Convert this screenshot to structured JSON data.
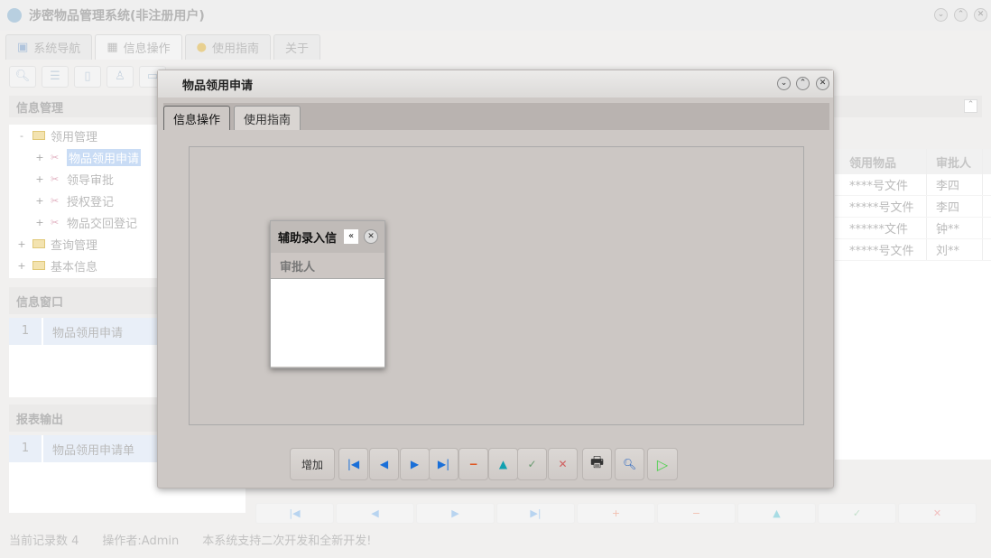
{
  "app": {
    "title": "涉密物品管理系统(非注册用户)",
    "tabs": [
      {
        "label": "系统导航",
        "icon": "monitor-icon"
      },
      {
        "label": "信息操作",
        "icon": "grid-icon"
      },
      {
        "label": "使用指南",
        "icon": "help-icon"
      },
      {
        "label": "关于"
      }
    ],
    "sections": {
      "info_mgmt": "信息管理",
      "info_window": "信息窗口",
      "report": "报表输出"
    },
    "tree": [
      {
        "label": "领用管理",
        "expanded": true,
        "children": [
          "物品领用申请",
          "领导审批",
          "授权登记",
          "物品交回登记"
        ]
      },
      {
        "label": "查询管理"
      },
      {
        "label": "基本信息"
      }
    ],
    "window_list": [
      {
        "n": "1",
        "label": "物品领用申请"
      }
    ],
    "report_list": [
      {
        "n": "1",
        "label": "物品领用申请单"
      }
    ],
    "grid": {
      "headers": [
        "领用物品",
        "审批人"
      ],
      "rows": [
        [
          "****号文件",
          "李四"
        ],
        [
          "*****号文件",
          "李四"
        ],
        [
          "******文件",
          "钟**"
        ],
        [
          "*****号文件",
          "刘**"
        ]
      ]
    },
    "status": {
      "records": "当前记录数 4",
      "operator": "操作者:Admin",
      "note": "本系统支持二次开发和全新开发!"
    }
  },
  "modal": {
    "title": "物品领用申请",
    "tabs": [
      "信息操作",
      "使用指南"
    ],
    "add_label": "增加",
    "sub_dialog": {
      "title": "辅助录入信",
      "column": "审批人"
    }
  }
}
